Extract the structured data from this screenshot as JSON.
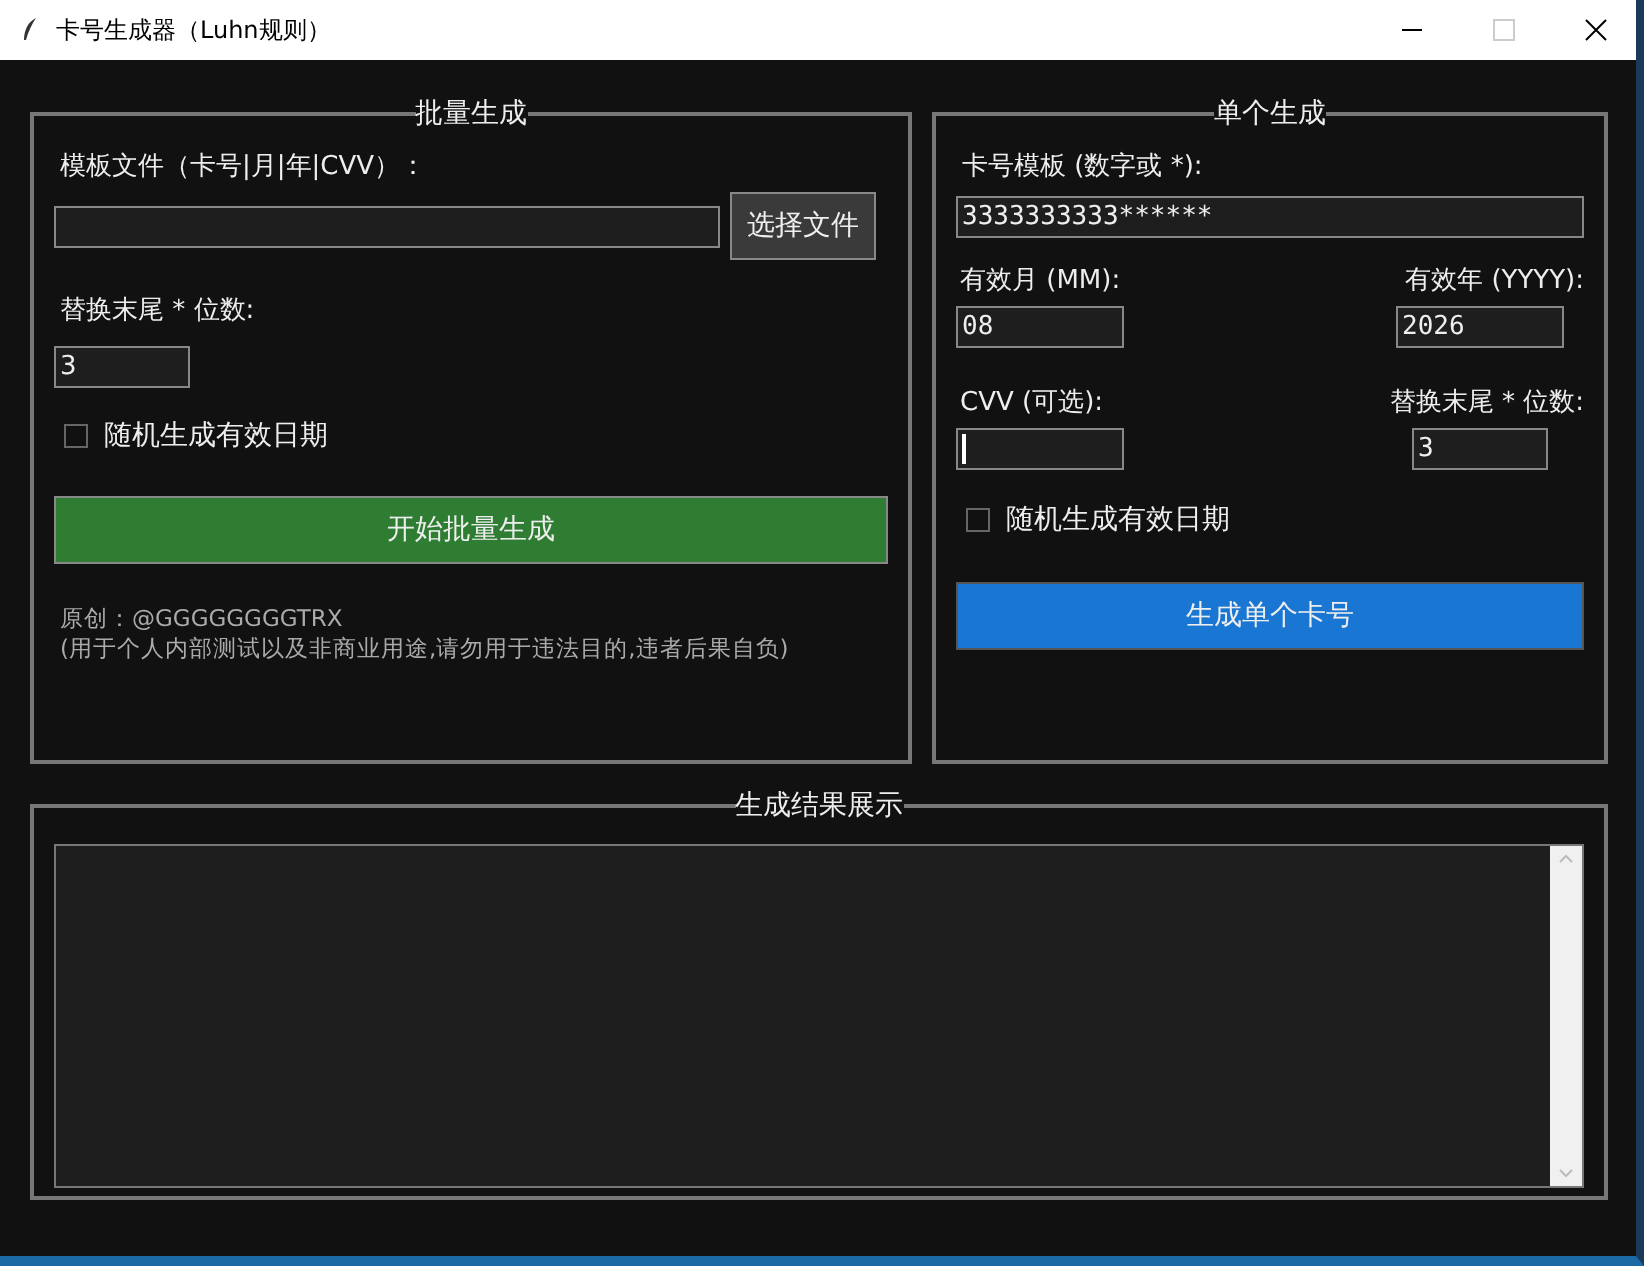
{
  "window": {
    "title": "卡号生成器（Luhn规则）"
  },
  "batch": {
    "legend": "批量生成",
    "template_label": "模板文件（卡号|月|年|CVV）：",
    "choose_button": "选择文件",
    "tail_label": "替换末尾 * 位数:",
    "tail_value": "3",
    "random_expiry": {
      "label": "随机生成有效日期",
      "checked": false
    },
    "start_button": "开始批量生成",
    "credit": "原创：@GGGGGGGGTRX",
    "disclaimer": "(用于个人内部测试以及非商业用途,请勿用于违法目的,违者后果自负)"
  },
  "single": {
    "legend": "单个生成",
    "template_label": "卡号模板 (数字或 *):",
    "template_value": "3333333333******",
    "month_label": "有效月 (MM):",
    "month_value": "08",
    "year_label": "有效年 (YYYY):",
    "year_value": "2026",
    "cvv_label": "CVV (可选):",
    "cvv_focused": true,
    "tail_label": "替换末尾 * 位数:",
    "tail_value": "3",
    "random_expiry": {
      "label": "随机生成有效日期",
      "checked": false
    },
    "generate_button": "生成单个卡号"
  },
  "results": {
    "legend": "生成结果展示"
  }
}
